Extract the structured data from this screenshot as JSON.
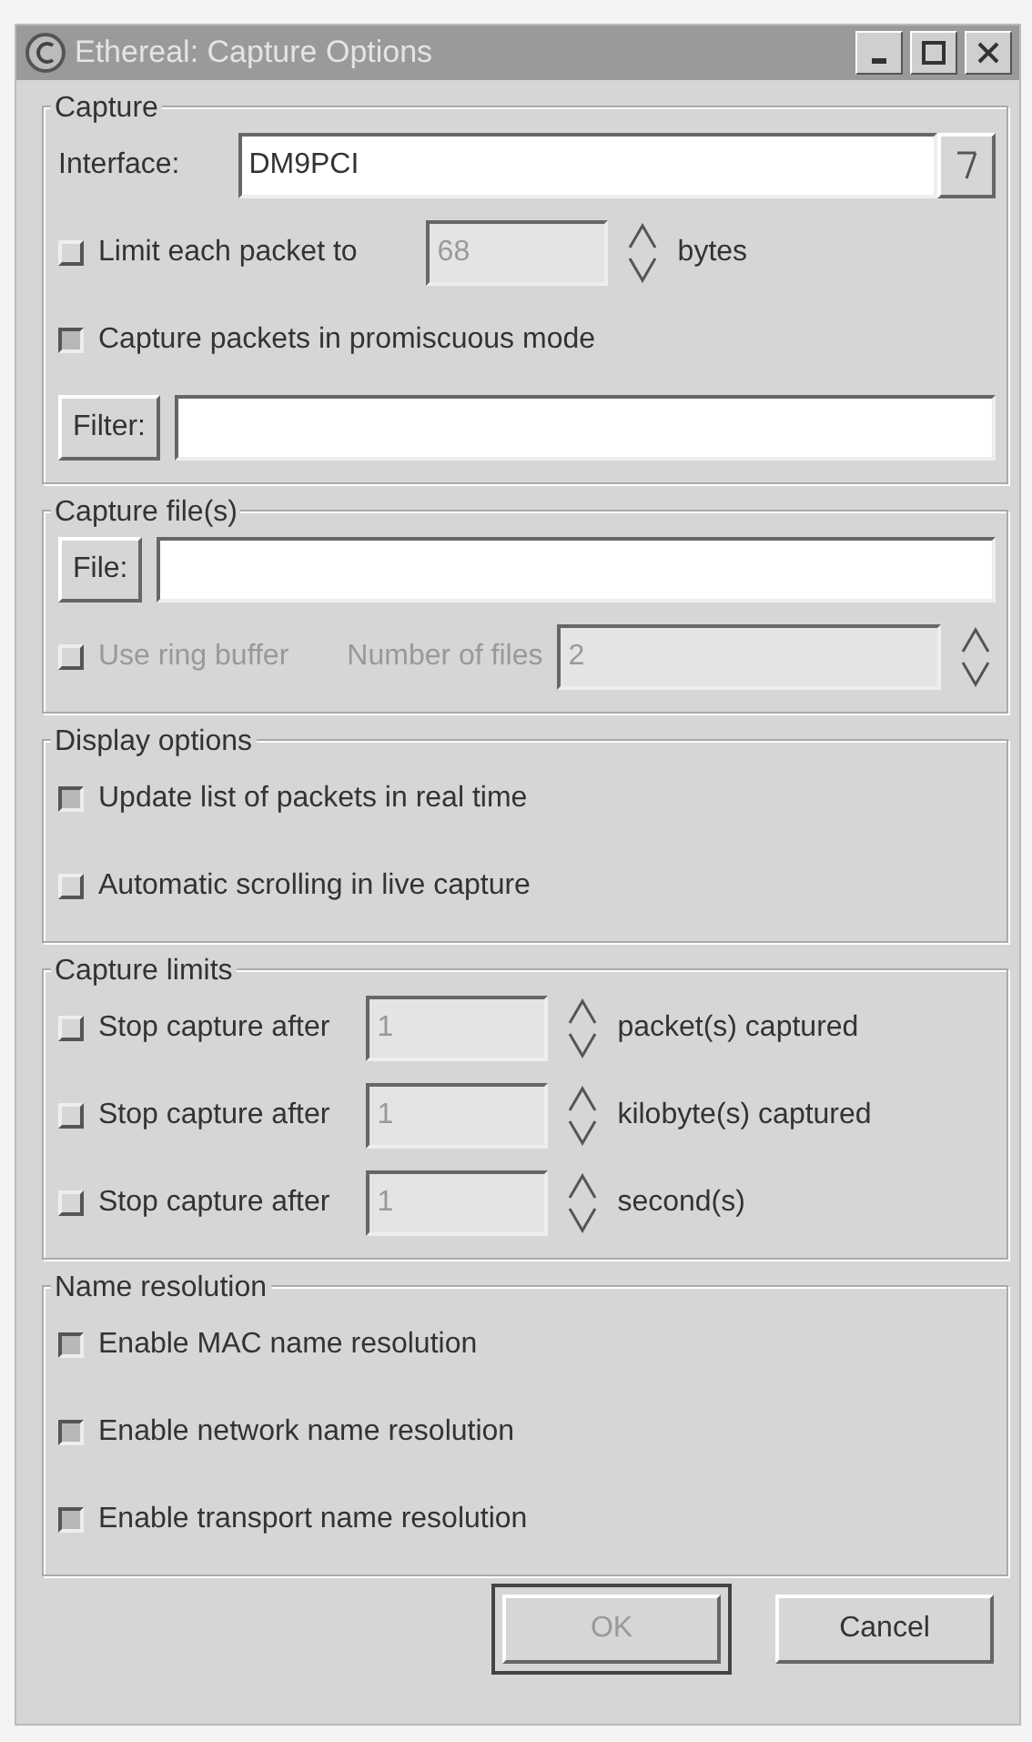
{
  "window": {
    "title": "Ethereal: Capture Options"
  },
  "sections": [
    {
      "title": "Capture",
      "rows": [
        {
          "kind": "combo",
          "label": "Interface:",
          "value": "DM9PCI"
        },
        {
          "kind": "spin",
          "checked": false,
          "disabled": false,
          "label": "Limit each packet to",
          "value": "68",
          "field_disabled": true,
          "unit": "bytes"
        },
        {
          "kind": "check",
          "checked": true,
          "disabled": false,
          "label": "Capture packets in promiscuous mode"
        },
        {
          "kind": "entry",
          "button": "Filter:"
        }
      ]
    },
    {
      "title": "Capture file(s)",
      "rows": [
        {
          "kind": "entry",
          "button": "File:"
        },
        {
          "kind": "ring",
          "checked": false,
          "disabled": true,
          "label": "Use ring buffer",
          "field_label": "Number of files",
          "value": "2",
          "field_disabled": true
        }
      ]
    },
    {
      "title": "Display options",
      "rows": [
        {
          "kind": "check",
          "checked": true,
          "disabled": false,
          "label": "Update list of packets in real time"
        },
        {
          "kind": "check",
          "checked": false,
          "disabled": false,
          "label": "Automatic scrolling in live capture"
        }
      ]
    },
    {
      "title": "Capture limits",
      "rows": [
        {
          "kind": "spin",
          "checked": false,
          "disabled": false,
          "label": "Stop capture after",
          "value": "1",
          "field_disabled": true,
          "unit": "packet(s) captured"
        },
        {
          "kind": "spin",
          "checked": false,
          "disabled": false,
          "label": "Stop capture after",
          "value": "1",
          "field_disabled": true,
          "unit": "kilobyte(s) captured"
        },
        {
          "kind": "spin",
          "checked": false,
          "disabled": false,
          "label": "Stop capture after",
          "value": "1",
          "field_disabled": true,
          "unit": "second(s)"
        }
      ]
    },
    {
      "title": "Name resolution",
      "rows": [
        {
          "kind": "check",
          "checked": true,
          "disabled": false,
          "label": "Enable MAC name resolution"
        },
        {
          "kind": "check",
          "checked": true,
          "disabled": false,
          "label": "Enable network name resolution"
        },
        {
          "kind": "check",
          "checked": true,
          "disabled": false,
          "label": "Enable transport name resolution"
        }
      ]
    }
  ],
  "buttons": [
    {
      "label": "OK",
      "default": true
    },
    {
      "label": "Cancel",
      "default": false
    }
  ]
}
